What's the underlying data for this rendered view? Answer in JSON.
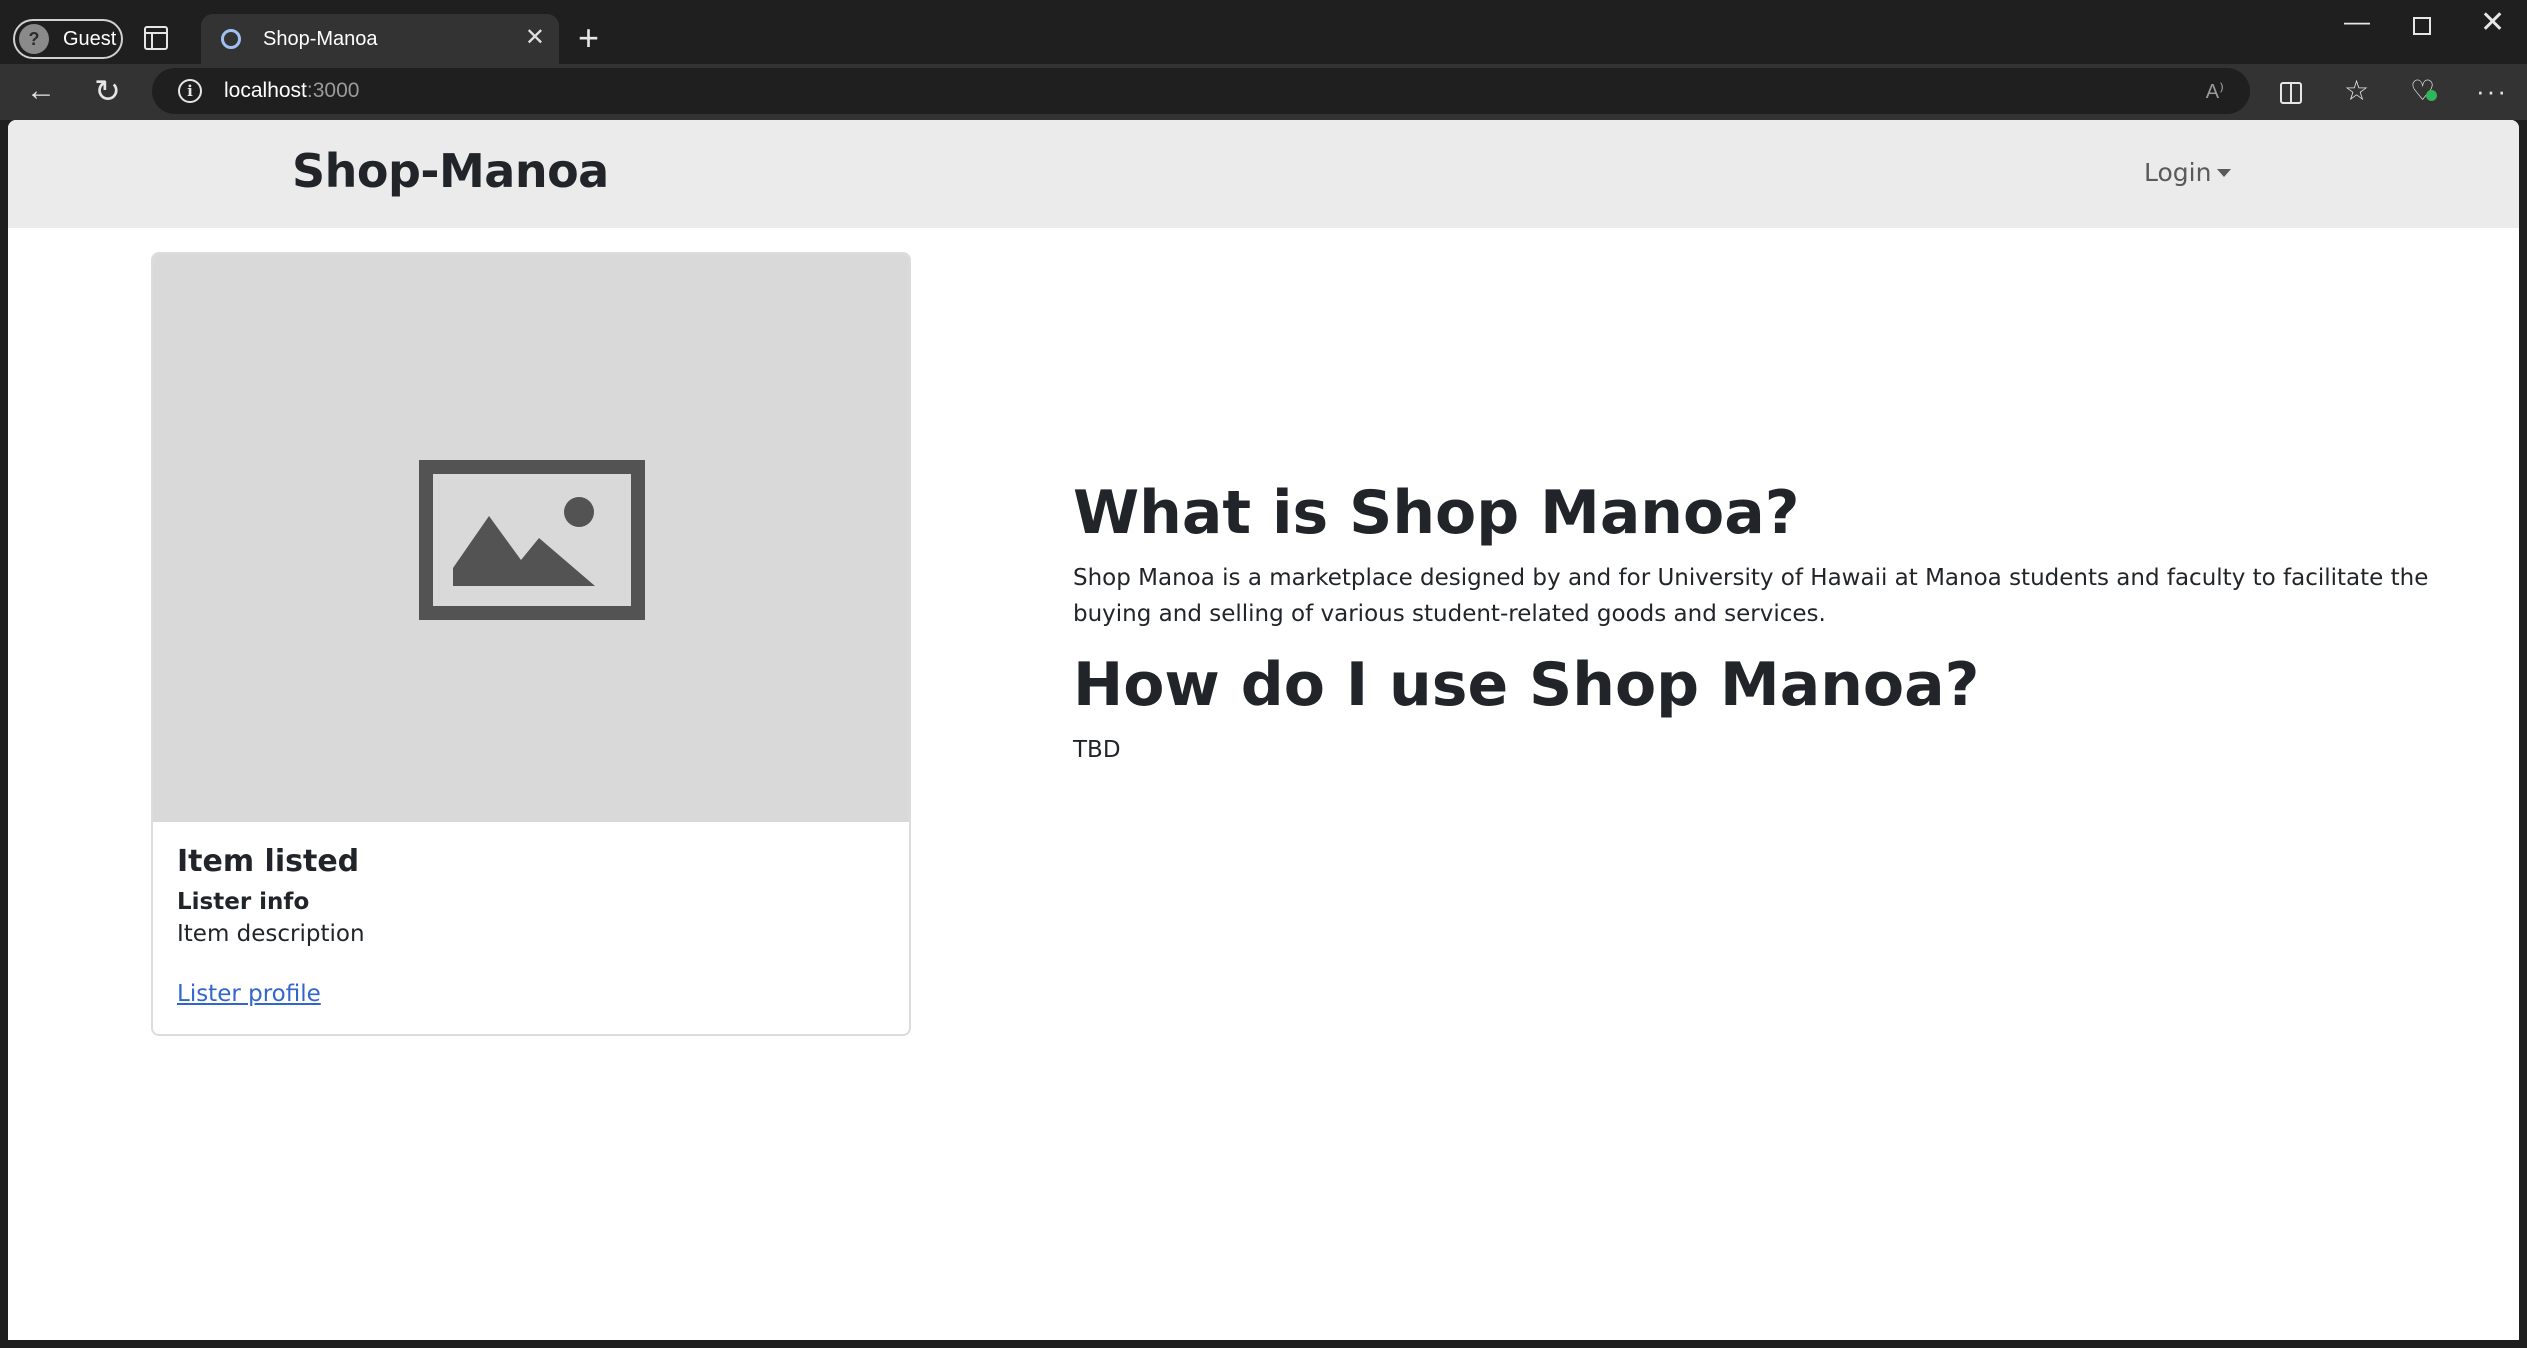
{
  "browser": {
    "profile_label": "Guest",
    "tab_title": "Shop-Manoa",
    "url_host": "localhost",
    "url_port": ":3000"
  },
  "navbar": {
    "brand": "Shop-Manoa",
    "login_label": "Login"
  },
  "card": {
    "title": "Item listed",
    "subtitle": "Lister info",
    "description": "Item description",
    "link_label": "Lister profile"
  },
  "info": {
    "heading1": "What is Shop Manoa?",
    "paragraph1": "Shop Manoa is a marketplace designed by and for University of Hawaii at Manoa students and faculty to facilitate the buying and selling of various student-related goods and services.",
    "heading2": "How do I use Shop Manoa?",
    "paragraph2": "TBD"
  },
  "colors": {
    "navbar_bg": "#ebebeb",
    "link": "#3366cc",
    "image_placeholder_bg": "#d9d9d9",
    "status_green": "#2fb55a"
  },
  "icons": [
    "tab-actions-icon",
    "favicon-icon",
    "close-icon",
    "plus-icon",
    "minimize-icon",
    "maximize-icon",
    "window-close-icon",
    "back-icon",
    "reload-icon",
    "info-icon",
    "read-aloud-icon",
    "split-screen-icon",
    "favorites-icon",
    "browser-essentials-icon",
    "more-icon",
    "image-placeholder-icon"
  ]
}
